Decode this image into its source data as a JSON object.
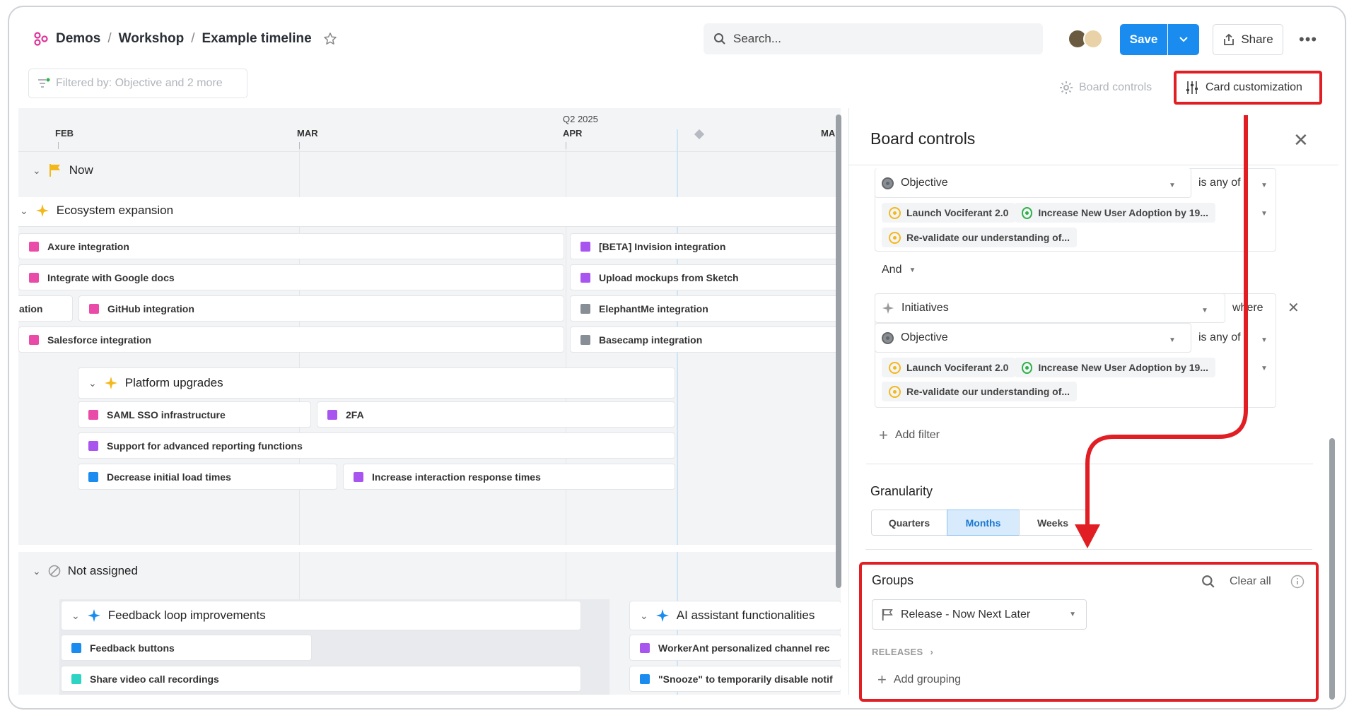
{
  "breadcrumb": {
    "items": [
      "Demos",
      "Workshop",
      "Example timeline"
    ]
  },
  "search": {
    "placeholder": "Search..."
  },
  "toolbar": {
    "save_label": "Save",
    "share_label": "Share"
  },
  "filter_bar": {
    "label": "Filtered by: Objective and 2 more"
  },
  "view_controls": {
    "board_controls": "Board controls",
    "card_customization": "Card customization"
  },
  "timeline": {
    "quarter_label": "Q2 2025",
    "months": [
      "FEB",
      "MAR",
      "APR",
      "MA"
    ],
    "groups": [
      {
        "title": "Now"
      },
      {
        "title": "Not assigned"
      }
    ],
    "initiatives": {
      "ecosystem": "Ecosystem expansion",
      "platform": "Platform upgrades",
      "feedback": "Feedback loop improvements",
      "ai": "AI assistant functionalities"
    },
    "cards": {
      "c1": "Axure integration",
      "c2": "[BETA] Invision integration",
      "c3": "Integrate with Google docs",
      "c4": "Upload mockups from Sketch",
      "c5": "ation",
      "c6": "GitHub integration",
      "c7": "ElephantMe integration",
      "c8": "Salesforce integration",
      "c9": "Basecamp integration",
      "c10": "SAML SSO infrastructure",
      "c11": "2FA",
      "c12": "Support for advanced reporting functions",
      "c13": "Decrease initial load times",
      "c14": "Increase interaction response times",
      "c15": "Feedback buttons",
      "c16": "Share video call recordings",
      "c17": "WorkerAnt personalized channel rec",
      "c18": "\"Snooze\" to temporarily disable notif"
    }
  },
  "panel": {
    "title": "Board controls",
    "filter1": {
      "field": "Objective",
      "operator": "is any of",
      "values": [
        "Launch Vociferant 2.0",
        "Increase New User Adoption by 19...",
        "Re-validate our understanding of..."
      ]
    },
    "conjunction": "And",
    "filter2": {
      "entity": "Initiatives",
      "where": "where",
      "field": "Objective",
      "operator": "is any of",
      "values": [
        "Launch Vociferant 2.0",
        "Increase New User Adoption by 19...",
        "Re-validate our understanding of..."
      ]
    },
    "add_filter": "Add filter",
    "granularity": {
      "label": "Granularity",
      "options": [
        "Quarters",
        "Months",
        "Weeks"
      ],
      "selected": "Months"
    },
    "groups": {
      "label": "Groups",
      "clear_all": "Clear all",
      "selected": "Release - Now Next Later",
      "sub_label": "RELEASES",
      "add_grouping": "Add grouping"
    }
  },
  "colors": {
    "accent": "#1a8cf0",
    "annotation": "#e01e24",
    "pink": "#ea4aa8",
    "purple": "#a855f0"
  }
}
